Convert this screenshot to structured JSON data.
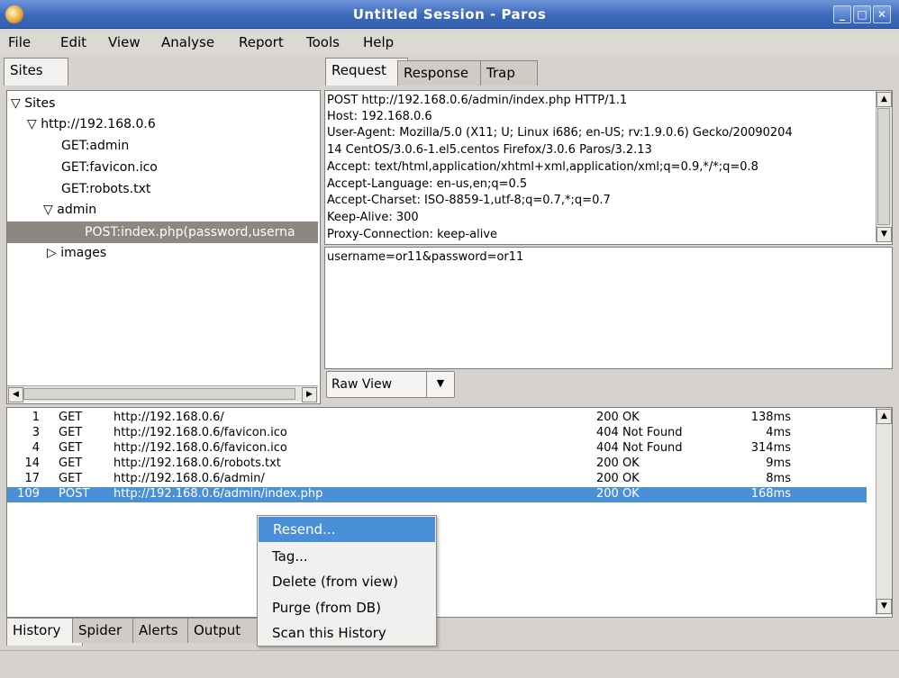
{
  "window": {
    "title": "Untitled Session - Paros"
  },
  "menu": [
    "File",
    "Edit",
    "View",
    "Analyse",
    "Report",
    "Tools",
    "Help"
  ],
  "sites_tab": "Sites",
  "tree": {
    "root": "Sites",
    "host": "http://192.168.0.6",
    "items": [
      "GET:admin",
      "GET:favicon.ico",
      "GET:robots.txt"
    ],
    "folder": "admin",
    "selected": "POST:index.php(password,userna",
    "images": "images"
  },
  "right_tabs": [
    "Request",
    "Response",
    "Trap"
  ],
  "request_header_lines": [
    "POST http://192.168.0.6/admin/index.php HTTP/1.1",
    "Host: 192.168.0.6",
    "User-Agent: Mozilla/5.0 (X11; U; Linux i686; en-US; rv:1.9.0.6) Gecko/20090204",
    "14 CentOS/3.0.6-1.el5.centos Firefox/3.0.6 Paros/3.2.13",
    "Accept: text/html,application/xhtml+xml,application/xml;q=0.9,*/*;q=0.8",
    "Accept-Language: en-us,en;q=0.5",
    "Accept-Charset: ISO-8859-1,utf-8;q=0.7,*;q=0.7",
    "Keep-Alive: 300",
    "Proxy-Connection: keep-alive"
  ],
  "request_body": "username=or11&password=or11",
  "view_select": "Raw View",
  "history": [
    {
      "id": "1",
      "method": "GET",
      "url": "http://192.168.0.6/",
      "status": "200 OK",
      "time": "138ms"
    },
    {
      "id": "3",
      "method": "GET",
      "url": "http://192.168.0.6/favicon.ico",
      "status": "404 Not Found",
      "time": "4ms"
    },
    {
      "id": "4",
      "method": "GET",
      "url": "http://192.168.0.6/favicon.ico",
      "status": "404 Not Found",
      "time": "314ms"
    },
    {
      "id": "14",
      "method": "GET",
      "url": "http://192.168.0.6/robots.txt",
      "status": "200 OK",
      "time": "9ms"
    },
    {
      "id": "17",
      "method": "GET",
      "url": "http://192.168.0.6/admin/",
      "status": "200 OK",
      "time": "8ms"
    },
    {
      "id": "109",
      "method": "POST",
      "url": "http://192.168.0.6/admin/index.php",
      "status": "200 OK",
      "time": "168ms"
    }
  ],
  "bottom_tabs": [
    "History",
    "Spider",
    "Alerts",
    "Output"
  ],
  "context_menu": [
    "Resend...",
    "Tag...",
    "Delete (from view)",
    "Purge (from DB)",
    "Scan this History"
  ],
  "colors": {
    "selection": "#4a90d9",
    "tree_selection": "#8c8780",
    "titlebar": "#3c68bb"
  }
}
